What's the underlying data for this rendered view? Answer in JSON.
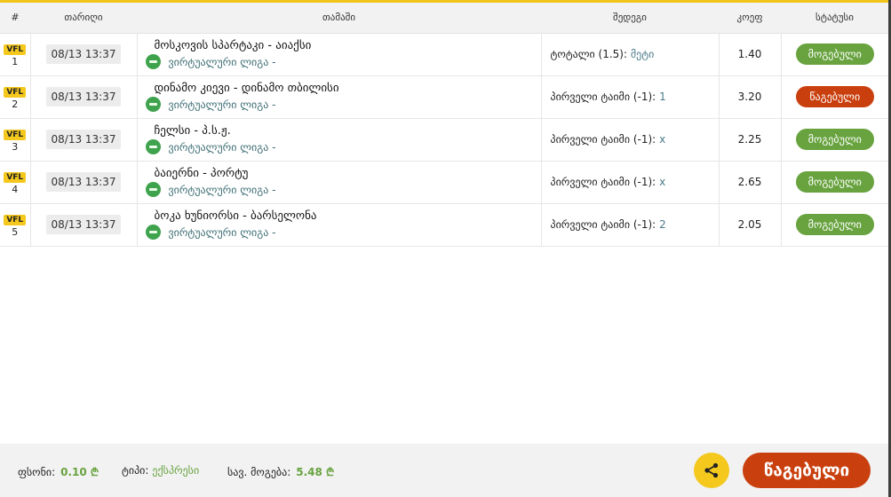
{
  "headers": {
    "num": "#",
    "date": "თარიღი",
    "game": "თამაში",
    "selection": "შედეგი",
    "odds": "კოეფ",
    "status": "სტატუსი"
  },
  "rows": [
    {
      "badge": "VFL",
      "num": "1",
      "date": "08/13 13:37",
      "game": "მოსკოვის სპარტაკი - აიაქსი",
      "league": "ვირტუალური ლიგა -",
      "selection_label": "ტოტალი (1.5):",
      "selection_value": "მეტი",
      "odds": "1.40",
      "status": "მოგებული",
      "status_kind": "won"
    },
    {
      "badge": "VFL",
      "num": "2",
      "date": "08/13 13:37",
      "game": "დინამო კიევი - დინამო თბილისი",
      "league": "ვირტუალური ლიგა -",
      "selection_label": "პირველი ტაიმი (-1):",
      "selection_value": "1",
      "odds": "3.20",
      "status": "წაგებული",
      "status_kind": "lost"
    },
    {
      "badge": "VFL",
      "num": "3",
      "date": "08/13 13:37",
      "game": "ჩელსი - პ.ს.ჟ.",
      "league": "ვირტუალური ლიგა -",
      "selection_label": "პირველი ტაიმი (-1):",
      "selection_value": "x",
      "odds": "2.25",
      "status": "მოგებული",
      "status_kind": "won"
    },
    {
      "badge": "VFL",
      "num": "4",
      "date": "08/13 13:37",
      "game": "ბაიერნი - პორტუ",
      "league": "ვირტუალური ლიგა -",
      "selection_label": "პირველი ტაიმი (-1):",
      "selection_value": "x",
      "odds": "2.65",
      "status": "მოგებული",
      "status_kind": "won"
    },
    {
      "badge": "VFL",
      "num": "5",
      "date": "08/13 13:37",
      "game": "ბოკა ხუნიორსი - ბარსელონა",
      "league": "ვირტუალური ლიგა -",
      "selection_label": "პირველი ტაიმი (-1):",
      "selection_value": "2",
      "odds": "2.05",
      "status": "მოგებული",
      "status_kind": "won"
    }
  ],
  "footer": {
    "stake_label": "ფსონი:",
    "stake_value": "0.10 ₾",
    "type_label": "ტიპი:",
    "type_value": "ექსპრესი",
    "total_win_label": "სავ. მოგება:",
    "total_win_value": "5.48 ₾",
    "share_icon": "share-icon",
    "overall_status": "წაგებული"
  },
  "colors": {
    "accent_yellow": "#f4c81d",
    "won_green": "#68a33f",
    "lost_red": "#c9400e"
  }
}
